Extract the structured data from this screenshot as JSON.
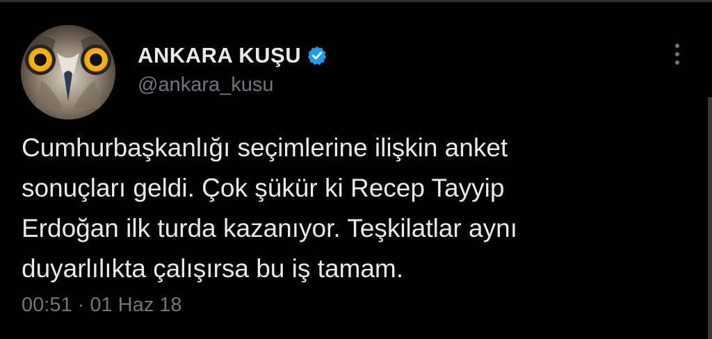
{
  "tweet": {
    "author": {
      "display_name": "ANKARA KUŞU",
      "handle": "@ankara_kusu",
      "verified": true,
      "avatar_icon": "owl-face-avatar"
    },
    "text": "Cumhurbaşkanlığı seçimlerine ilişkin anket\nsonuçları geldi. Çok şükür ki Recep Tayyip\nErdoğan ilk turda kazanıyor. Teşkilatlar aynı\nduyarlılıkta çalışırsa bu iş tamam.",
    "timestamp": "00:51 · 01 Haz 18",
    "more_icon": "more-vertical-icon"
  },
  "colors": {
    "background": "#000000",
    "primary_text": "#e7e9ea",
    "secondary_text": "#71767b",
    "verified_badge": "#1d9bf0"
  }
}
